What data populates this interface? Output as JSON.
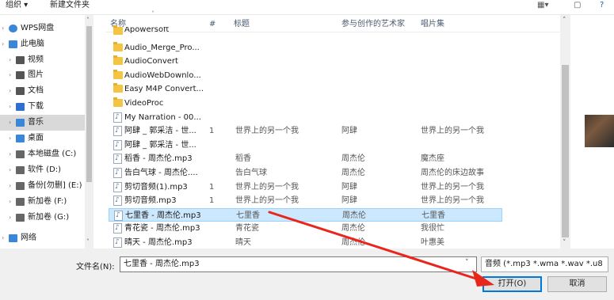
{
  "toolbar": {
    "organize_label": "组织 ▾",
    "new_folder_label": "新建文件夹",
    "view_icon_label": "▦▾",
    "pane_icon_label": "▢",
    "help_icon_label": "?"
  },
  "nav": {
    "items": [
      {
        "label": "WPS网盘",
        "icon": "cloud-icon",
        "color": "#3a86d8"
      },
      {
        "label": "此电脑",
        "icon": "computer-icon",
        "color": "#3a86d8"
      },
      {
        "label": "视频",
        "icon": "video-icon",
        "color": "#555"
      },
      {
        "label": "图片",
        "icon": "pictures-icon",
        "color": "#555"
      },
      {
        "label": "文档",
        "icon": "documents-icon",
        "color": "#555"
      },
      {
        "label": "下载",
        "icon": "download-icon",
        "color": "#2f6fd0"
      },
      {
        "label": "音乐",
        "icon": "music-icon",
        "color": "#3a86d8"
      },
      {
        "label": "桌面",
        "icon": "desktop-icon",
        "color": "#3a86d8"
      },
      {
        "label": "本地磁盘 (C:)",
        "icon": "drive-icon",
        "color": "#666"
      },
      {
        "label": "软件 (D:)",
        "icon": "drive-icon",
        "color": "#666"
      },
      {
        "label": "备份[勿删] (E:)",
        "icon": "drive-icon",
        "color": "#666"
      },
      {
        "label": "新加卷 (F:)",
        "icon": "drive-icon",
        "color": "#666"
      },
      {
        "label": "新加卷 (G:)",
        "icon": "drive-icon",
        "color": "#666"
      },
      {
        "label": "网络",
        "icon": "network-icon",
        "color": "#3a86d8"
      }
    ]
  },
  "list": {
    "headers": {
      "name": "名称",
      "num": "#",
      "title": "标题",
      "artist": "参与创作的艺术家",
      "album": "唱片集"
    },
    "rows": [
      {
        "type": "folder",
        "name": "Apowersoft",
        "num": "",
        "title": "",
        "artist": "",
        "album": ""
      },
      {
        "type": "folder",
        "name": "Audio_Merge_Pro...",
        "num": "",
        "title": "",
        "artist": "",
        "album": ""
      },
      {
        "type": "folder",
        "name": "AudioConvert",
        "num": "",
        "title": "",
        "artist": "",
        "album": ""
      },
      {
        "type": "folder",
        "name": "AudioWebDownlo...",
        "num": "",
        "title": "",
        "artist": "",
        "album": ""
      },
      {
        "type": "folder",
        "name": "Easy M4P Convert...",
        "num": "",
        "title": "",
        "artist": "",
        "album": ""
      },
      {
        "type": "folder",
        "name": "VideoProc",
        "num": "",
        "title": "",
        "artist": "",
        "album": ""
      },
      {
        "type": "music",
        "name": "My Narration - 00...",
        "num": "",
        "title": "",
        "artist": "",
        "album": ""
      },
      {
        "type": "music",
        "name": "阿肆 _ 郭采洁 - 世...",
        "num": "1",
        "title": "世界上的另一个我",
        "artist": "阿肆",
        "album": "世界上的另一个我"
      },
      {
        "type": "music",
        "name": "阿肆 _ 郭采洁 - 世...",
        "num": "",
        "title": "",
        "artist": "",
        "album": ""
      },
      {
        "type": "music",
        "name": "稻香 - 周杰伦.mp3",
        "num": "",
        "title": "稻香",
        "artist": "周杰伦",
        "album": "魔杰座"
      },
      {
        "type": "music",
        "name": "告白气球 - 周杰伦....",
        "num": "",
        "title": "告白气球",
        "artist": "周杰伦",
        "album": "周杰伦的床边故事"
      },
      {
        "type": "music",
        "name": "剪切音频(1).mp3",
        "num": "1",
        "title": "世界上的另一个我",
        "artist": "阿肆",
        "album": "世界上的另一个我"
      },
      {
        "type": "music",
        "name": "剪切音频.mp3",
        "num": "1",
        "title": "世界上的另一个我",
        "artist": "阿肆",
        "album": "世界上的另一个我"
      },
      {
        "type": "music",
        "name": "七里香 - 周杰伦.mp3",
        "num": "",
        "title": "七里香",
        "artist": "周杰伦",
        "album": "七里香",
        "selected": true
      },
      {
        "type": "music",
        "name": "青花瓷 - 周杰伦.mp3",
        "num": "",
        "title": "青花瓷",
        "artist": "周杰伦",
        "album": "我很忙"
      },
      {
        "type": "music",
        "name": "晴天 - 周杰伦.mp3",
        "num": "",
        "title": "晴天",
        "artist": "周杰伦",
        "album": "叶惠美"
      }
    ]
  },
  "bottom": {
    "filename_label": "文件名(N):",
    "filename_value": "七里香 - 周杰伦.mp3",
    "filetype_value": "音频 (*.mp3 *.wma *.wav *.u8",
    "open_label": "打开(O)",
    "cancel_label": "取消"
  },
  "colors": {
    "selection": "#cce8ff",
    "annotation_arrow": "#e8261c",
    "accent": "#0078d7"
  }
}
